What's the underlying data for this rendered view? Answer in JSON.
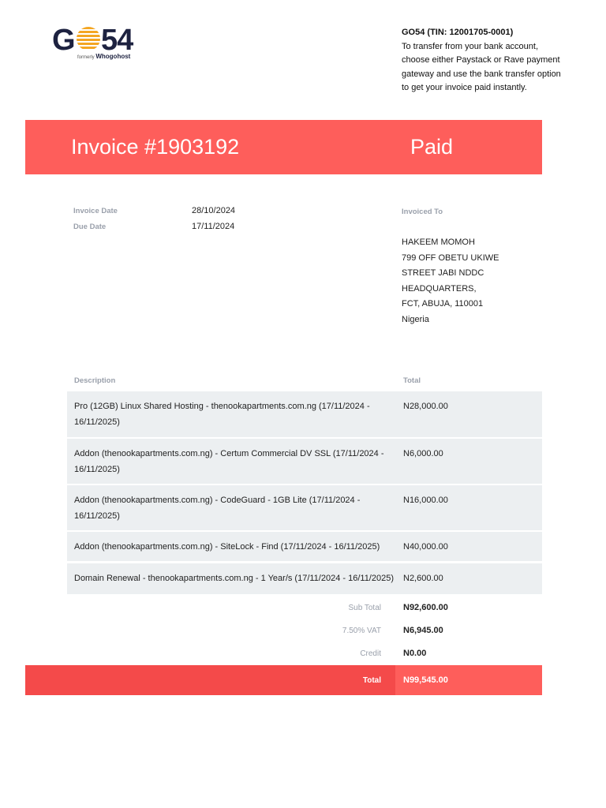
{
  "logo": {
    "text_go": "G",
    "text_54": "54",
    "formerly": "formerly",
    "brand": "Whogohost"
  },
  "company": {
    "title": "GO54 (TIN: 12001705-0001)",
    "lines": [
      "To transfer from your bank account,",
      "choose either Paystack or Rave payment",
      "gateway and use the bank transfer option",
      "to get your invoice paid instantly."
    ]
  },
  "invoice": {
    "title": "Invoice #1903192",
    "status": "Paid",
    "date_label": "Invoice Date",
    "date": "28/10/2024",
    "due_label": "Due Date",
    "due": "17/11/2024"
  },
  "invoiced_to": {
    "label": "Invoiced To",
    "lines": [
      "HAKEEM MOMOH",
      "799 OFF OBETU UKIWE",
      "STREET JABI NDDC",
      "HEADQUARTERS,",
      "FCT, ABUJA, 110001",
      "Nigeria"
    ]
  },
  "table": {
    "headers": {
      "description": "Description",
      "total": "Total"
    },
    "rows": [
      {
        "description": "Pro (12GB) Linux Shared Hosting - thenookapartments.com.ng (17/11/2024 - 16/11/2025)",
        "total": "N28,000.00"
      },
      {
        "description": "Addon (thenookapartments.com.ng) - Certum Commercial DV SSL (17/11/2024 - 16/11/2025)",
        "total": "N6,000.00"
      },
      {
        "description": "Addon (thenookapartments.com.ng) - CodeGuard - 1GB Lite (17/11/2024 - 16/11/2025)",
        "total": "N16,000.00"
      },
      {
        "description": "Addon (thenookapartments.com.ng) - SiteLock - Find (17/11/2024 - 16/11/2025)",
        "total": "N40,000.00"
      },
      {
        "description": "Domain Renewal - thenookapartments.com.ng - 1 Year/s (17/11/2024 - 16/11/2025)",
        "total": "N2,600.00"
      }
    ]
  },
  "summary": {
    "subtotal_label": "Sub Total",
    "subtotal": "N92,600.00",
    "vat_label": "7.50% VAT",
    "vat": "N6,945.00",
    "credit_label": "Credit",
    "credit": "N0.00",
    "total_label": "Total",
    "total": "N99,545.00"
  },
  "colors": {
    "accent": "#fe5e5b",
    "accent_dark": "#f44a4a",
    "row_bg": "#eceff1"
  }
}
